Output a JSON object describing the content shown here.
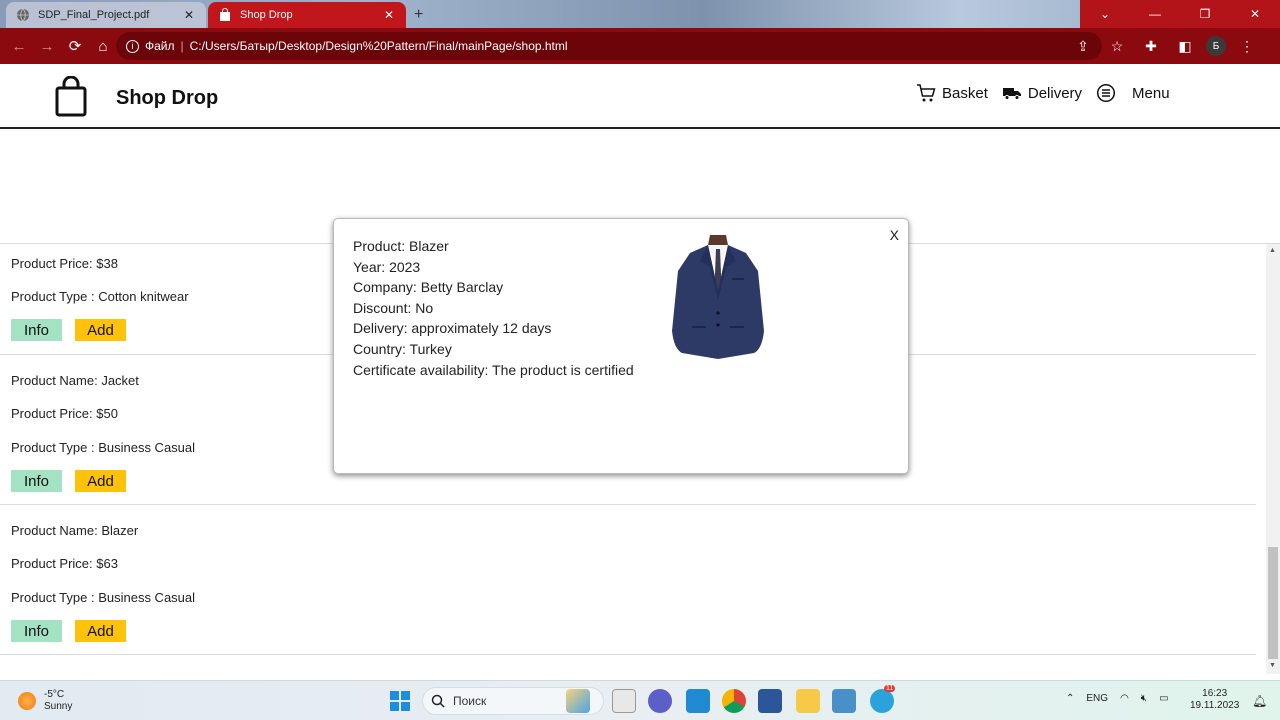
{
  "browser": {
    "tabs": [
      {
        "title": "SDP_Final_Project.pdf",
        "active": false
      },
      {
        "title": "Shop Drop",
        "active": true
      }
    ],
    "address": {
      "scheme_label": "Файл",
      "url": "C:/Users/Батыр/Desktop/Design%20Pattern/Final/mainPage/shop.html"
    },
    "profile_initial": "Б"
  },
  "site": {
    "brand": "Shop Drop",
    "nav": [
      {
        "label": "Basket",
        "icon": "cart-icon"
      },
      {
        "label": "Delivery",
        "icon": "delivery-truck-icon"
      },
      {
        "label": "Menu",
        "icon": "menu-icon"
      }
    ]
  },
  "products": [
    {
      "name": "",
      "price": "Product Price: $38",
      "type": "Product Type : Cotton knitwear"
    },
    {
      "name": "Product Name: Jacket",
      "price": "Product Price: $50",
      "type": "Product Type : Business Casual"
    },
    {
      "name": "Product Name: Blazer",
      "price": "Product Price: $63",
      "type": "Product Type : Business Casual"
    }
  ],
  "buttons": {
    "info": "Info",
    "add": "Add"
  },
  "modal": {
    "close": "X",
    "lines": [
      "Product: Blazer",
      "Year: 2023",
      "Company: Betty Barclay",
      "Discount: No",
      "Delivery: approximately 12 days",
      "Country: Turkey",
      "Certificate availability: The product is certified"
    ]
  },
  "taskbar": {
    "temperature": "-5°C",
    "condition": "Sunny",
    "search_placeholder": "Поиск",
    "language": "ENG",
    "time": "16:23",
    "date": "19.11.2023",
    "telegram_badge": "11"
  }
}
